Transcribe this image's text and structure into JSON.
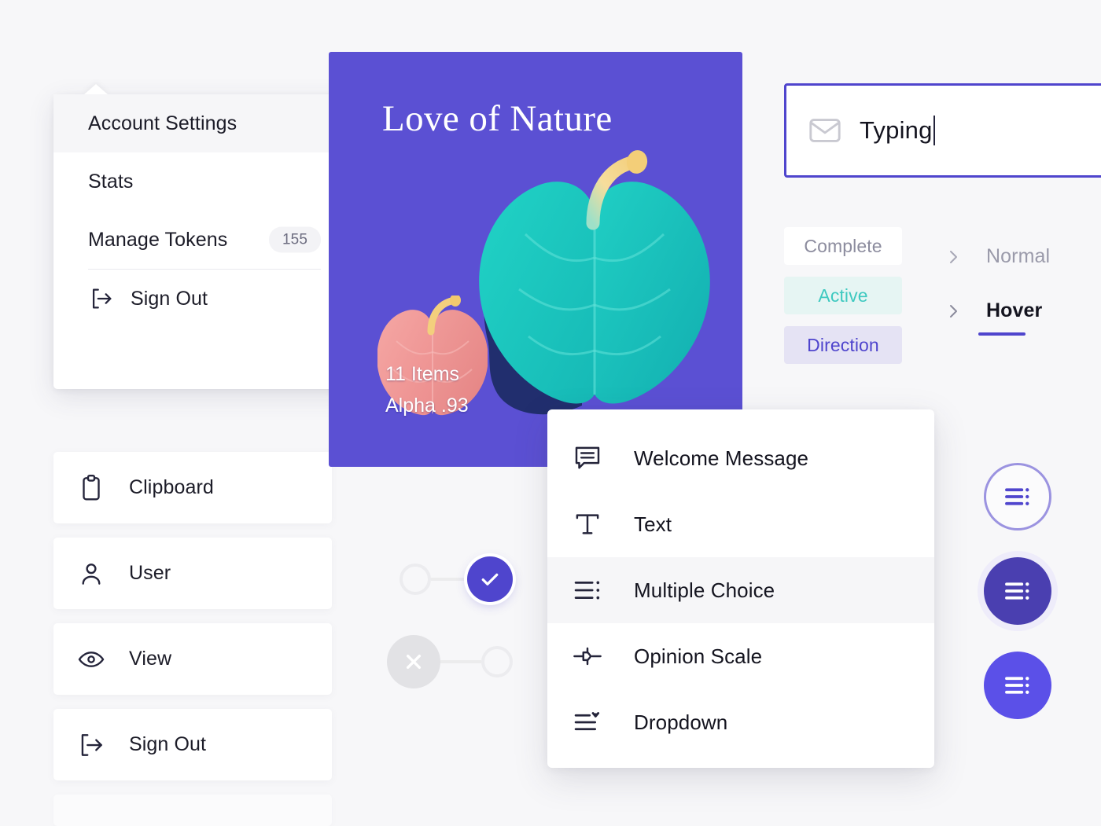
{
  "account_menu": {
    "items": [
      {
        "label": "Account Settings",
        "icon": "",
        "badge": "",
        "highlighted": true
      },
      {
        "label": "Stats",
        "icon": "",
        "badge": "",
        "highlighted": false
      },
      {
        "label": "Manage Tokens",
        "icon": "",
        "badge": "155",
        "highlighted": false
      },
      {
        "label": "Sign Out",
        "icon": "sign-out-icon",
        "badge": "",
        "highlighted": false
      }
    ]
  },
  "nav_list": {
    "items": [
      {
        "label": "Clipboard",
        "icon": "clipboard-icon"
      },
      {
        "label": "User",
        "icon": "user-icon"
      },
      {
        "label": "View",
        "icon": "eye-icon"
      },
      {
        "label": "Sign Out",
        "icon": "sign-out-icon"
      }
    ]
  },
  "nature_card": {
    "title": "Love of Nature",
    "items_count": "11 Items",
    "alpha": "Alpha .93",
    "background_color": "#5b50d3",
    "leaf_color": "#1ecfc4",
    "small_leaf_color": "#f09a9a",
    "stem_color": "#f7d98a"
  },
  "email_input": {
    "icon": "envelope-icon",
    "value": "Typing",
    "placeholder": "Typing",
    "border_color": "#4f45cd"
  },
  "status_pills": [
    {
      "label": "Complete",
      "bg": "#ffffff",
      "color": "#8c8c9e"
    },
    {
      "label": "Active",
      "bg": "#e6f5f3",
      "color": "#3fc9c0"
    },
    {
      "label": "Direction",
      "bg": "#e5e3f4",
      "color": "#4f45cd"
    }
  ],
  "state_links": [
    {
      "label": "Normal",
      "icon": "chevron-right-icon",
      "active": false
    },
    {
      "label": "Hover",
      "icon": "chevron-right-icon",
      "active": true
    }
  ],
  "toggles": [
    {
      "state": "on",
      "icon": "check-icon",
      "accent": "#4f45cd"
    },
    {
      "state": "off",
      "icon": "close-icon",
      "accent": "#e2e2e5"
    }
  ],
  "question_types": {
    "items": [
      {
        "label": "Welcome Message",
        "icon": "speech-bubble-icon",
        "highlighted": false
      },
      {
        "label": "Text",
        "icon": "text-t-icon",
        "highlighted": false
      },
      {
        "label": "Multiple Choice",
        "icon": "list-bullet-icon",
        "highlighted": true
      },
      {
        "label": "Opinion Scale",
        "icon": "slider-icon",
        "highlighted": false
      },
      {
        "label": "Dropdown",
        "icon": "dropdown-list-icon",
        "highlighted": false
      }
    ]
  },
  "circle_buttons": [
    {
      "icon": "list-icon",
      "style": "outline",
      "color": "#4f45cd"
    },
    {
      "icon": "list-icon",
      "style": "filled-dark",
      "color": "#4a3fb0"
    },
    {
      "icon": "list-icon",
      "style": "filled-light",
      "color": "#5b50e8"
    }
  ]
}
